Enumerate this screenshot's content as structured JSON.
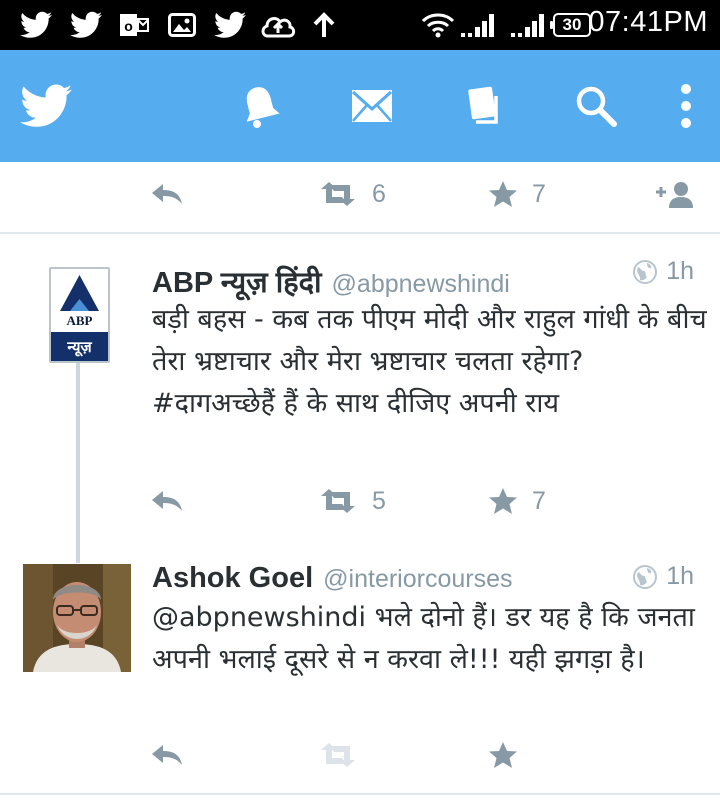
{
  "status_bar": {
    "time": "07:41PM",
    "battery": "30",
    "icons": [
      "twitter-icon",
      "twitter-icon",
      "outlook-icon",
      "gallery-icon",
      "twitter-icon",
      "cloud-upload-icon",
      "upload-arrow-icon",
      "wifi-icon",
      "signal-icon",
      "signal-icon",
      "battery-icon"
    ]
  },
  "toolbar": {
    "icons": [
      "twitter-bird-icon",
      "notifications-bell-icon",
      "messages-envelope-icon",
      "drafts-icon",
      "search-icon",
      "overflow-menu-icon"
    ]
  },
  "colors": {
    "toolbar": "#55acee",
    "muted": "#8899a6",
    "text": "#292f33",
    "divider": "#e1e8ed"
  },
  "top_actions": {
    "retweets": "6",
    "favorites": "7"
  },
  "tweets": [
    {
      "name": "ABP न्यूज़ हिंदी",
      "handle": "@abpnewshindi",
      "time": "1h",
      "text": "बड़ी बहस - कब तक पीएम मोदी और राहुल गांधी के बीच तेरा भ्रष्टाचार और मेरा भ्रष्टाचार चलता रहेगा?  #दागअच्छेहैं हैं के साथ दीजिए अपनी राय",
      "retweets": "5",
      "favorites": "7",
      "avatar": {
        "brand": "ABP",
        "caption": "न्यूज़"
      }
    },
    {
      "name": "Ashok Goel",
      "handle": "@interiorcourses",
      "time": "1h",
      "text": "@abpnewshindi भले दोनो हैं। डर यह है कि जनता अपनी भलाई दूसरे से न करवा ले!!! यही झगड़ा है।"
    }
  ]
}
